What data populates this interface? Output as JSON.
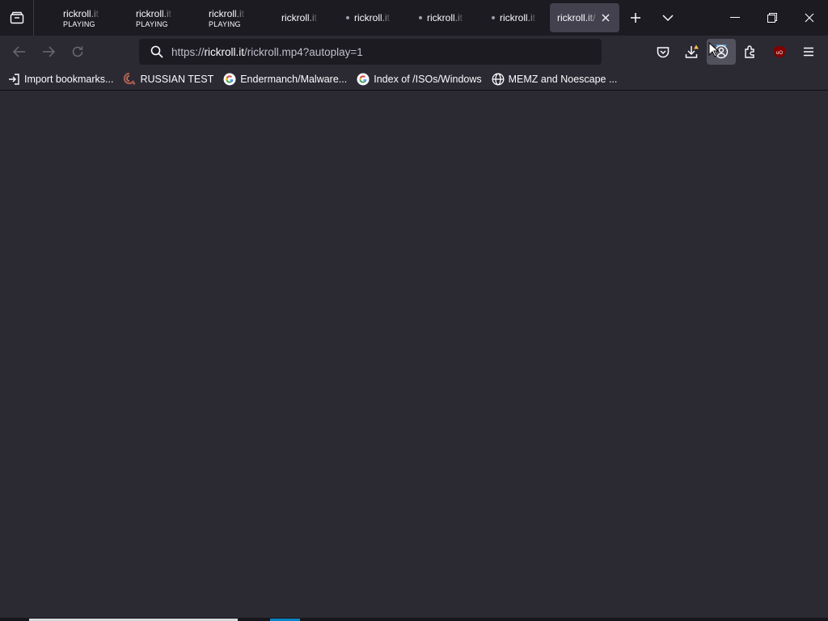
{
  "tabs": [
    {
      "title": "rickroll.it",
      "subtitle": "PLAYING",
      "active": false,
      "dot": false
    },
    {
      "title": "rickroll.it",
      "subtitle": "PLAYING",
      "active": false,
      "dot": false
    },
    {
      "title": "rickroll.it",
      "subtitle": "PLAYING",
      "active": false,
      "dot": false
    },
    {
      "title": "rickroll.it",
      "subtitle": "",
      "active": false,
      "dot": false
    },
    {
      "title": "rickroll.it",
      "subtitle": "",
      "active": false,
      "dot": true
    },
    {
      "title": "rickroll.it",
      "subtitle": "",
      "active": false,
      "dot": true
    },
    {
      "title": "rickroll.it",
      "subtitle": "",
      "active": false,
      "dot": true
    },
    {
      "title": "rickroll.it/",
      "subtitle": "",
      "active": true,
      "dot": false
    }
  ],
  "url": {
    "scheme": "https://",
    "domain": "rickroll.it",
    "path": "/rickroll.mp4?autoplay=1"
  },
  "bookmarks": [
    {
      "label": "Import bookmarks...",
      "icon": "import-icon"
    },
    {
      "label": "RUSSIAN TEST",
      "icon": "site-favicon"
    },
    {
      "label": "Endermanch/Malware...",
      "icon": "google-favicon"
    },
    {
      "label": "Index of /ISOs/Windows",
      "icon": "google-favicon"
    },
    {
      "label": "MEMZ and Noescape ...",
      "icon": "globe-icon"
    }
  ],
  "colors": {
    "tabbar_bg": "#1c1b22",
    "toolbar_bg": "#2b2a33",
    "active_tab": "#42414d",
    "accent": "#0a84c6"
  }
}
